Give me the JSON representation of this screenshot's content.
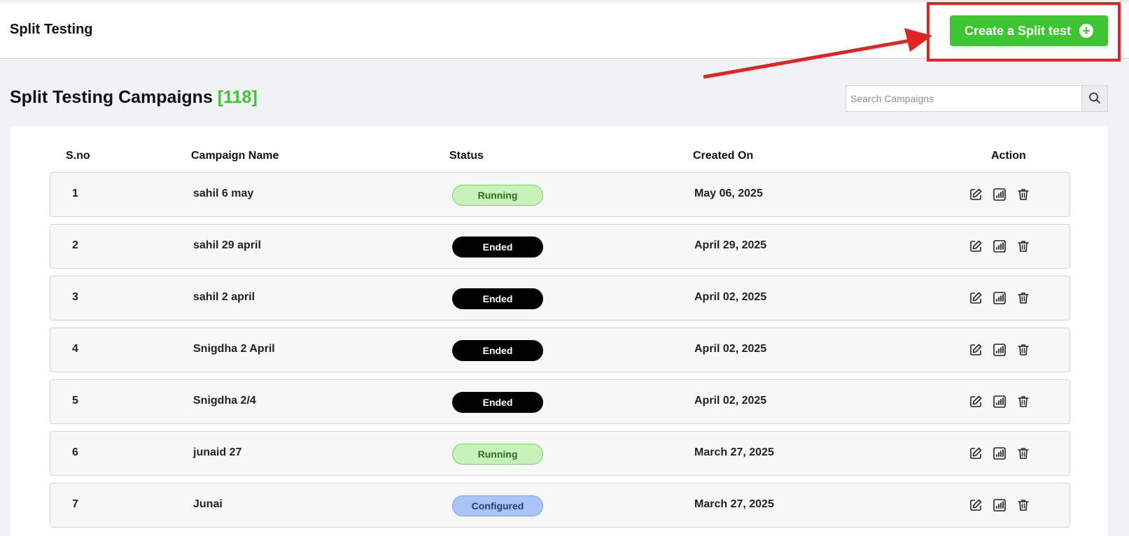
{
  "header": {
    "title": "Split Testing",
    "create_button_label": "Create a Split test"
  },
  "section": {
    "title": "Split Testing Campaigns",
    "count": "[118]"
  },
  "search": {
    "placeholder": "Search Campaigns",
    "value": ""
  },
  "table": {
    "columns": [
      "S.no",
      "Campaign Name",
      "Status",
      "Created On",
      "Action"
    ],
    "rows": [
      {
        "sno": "1",
        "name": "sahil 6 may",
        "status": "Running",
        "status_type": "running",
        "created": "May 06, 2025"
      },
      {
        "sno": "2",
        "name": "sahil 29 april",
        "status": "Ended",
        "status_type": "ended",
        "created": "April 29, 2025"
      },
      {
        "sno": "3",
        "name": "sahil 2 april",
        "status": "Ended",
        "status_type": "ended",
        "created": "April 02, 2025"
      },
      {
        "sno": "4",
        "name": "Snigdha 2 April",
        "status": "Ended",
        "status_type": "ended",
        "created": "April 02, 2025"
      },
      {
        "sno": "5",
        "name": "Snigdha 2/4",
        "status": "Ended",
        "status_type": "ended",
        "created": "April 02, 2025"
      },
      {
        "sno": "6",
        "name": "junaid 27",
        "status": "Running",
        "status_type": "running",
        "created": "March 27, 2025"
      },
      {
        "sno": "7",
        "name": "Junai",
        "status": "Configured",
        "status_type": "configured",
        "created": "March 27, 2025"
      }
    ],
    "action_icons": [
      "edit-icon",
      "bar-chart-icon",
      "trash-icon"
    ]
  },
  "colors": {
    "accent_green": "#3ec632",
    "annotation_red": "#e02424",
    "running_bg": "#c7f2b9",
    "ended_bg": "#000000",
    "configured_bg": "#a9c4f5"
  },
  "icons": {
    "search": "search-icon",
    "plus": "plus-circle-icon"
  }
}
